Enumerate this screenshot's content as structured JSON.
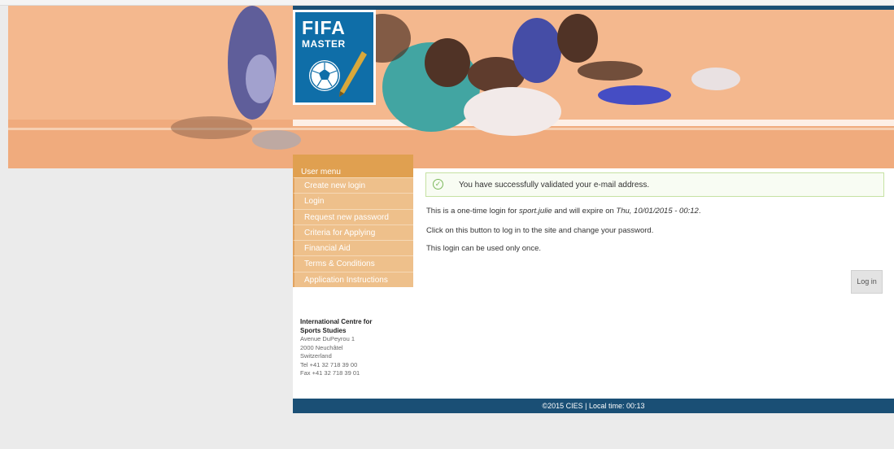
{
  "logo": {
    "line1": "FIFA",
    "line2": "MASTER"
  },
  "menu": {
    "title": "User menu",
    "items": [
      {
        "label": "Create new login"
      },
      {
        "label": "Login"
      },
      {
        "label": "Request new password"
      },
      {
        "label": "Criteria for Applying"
      },
      {
        "label": "Financial Aid"
      },
      {
        "label": "Terms & Conditions"
      },
      {
        "label": "Application Instructions"
      }
    ]
  },
  "address": {
    "org_line1": "International Centre for",
    "org_line2": "Sports Studies",
    "street": "Avenue DuPeyrou 1",
    "city": "2000 Neuchâtel",
    "country": "Switzerland",
    "tel": "Tel +41 32 718 39 00",
    "fax": "Fax +41 32 718 39 01"
  },
  "content": {
    "status_message": "You have successfully validated your e-mail address.",
    "line1_prefix": "This is a one-time login for ",
    "line1_user": "sport.julie",
    "line1_mid": " and will expire on ",
    "line1_date": "Thu, 10/01/2015 - 00:12",
    "line1_suffix": ".",
    "line2": "Click on this button to log in to the site and change your password.",
    "line3": "This login can be used only once.",
    "login_button": "Log in"
  },
  "footer": {
    "text": "©2015 CIES | Local time: 00:13"
  },
  "colors": {
    "banner_bg": "#f4b98f",
    "navy": "#1a4f75",
    "menu_title": "#e0a050",
    "menu_item": "#eec08b",
    "success_border": "#c6e2a3"
  }
}
